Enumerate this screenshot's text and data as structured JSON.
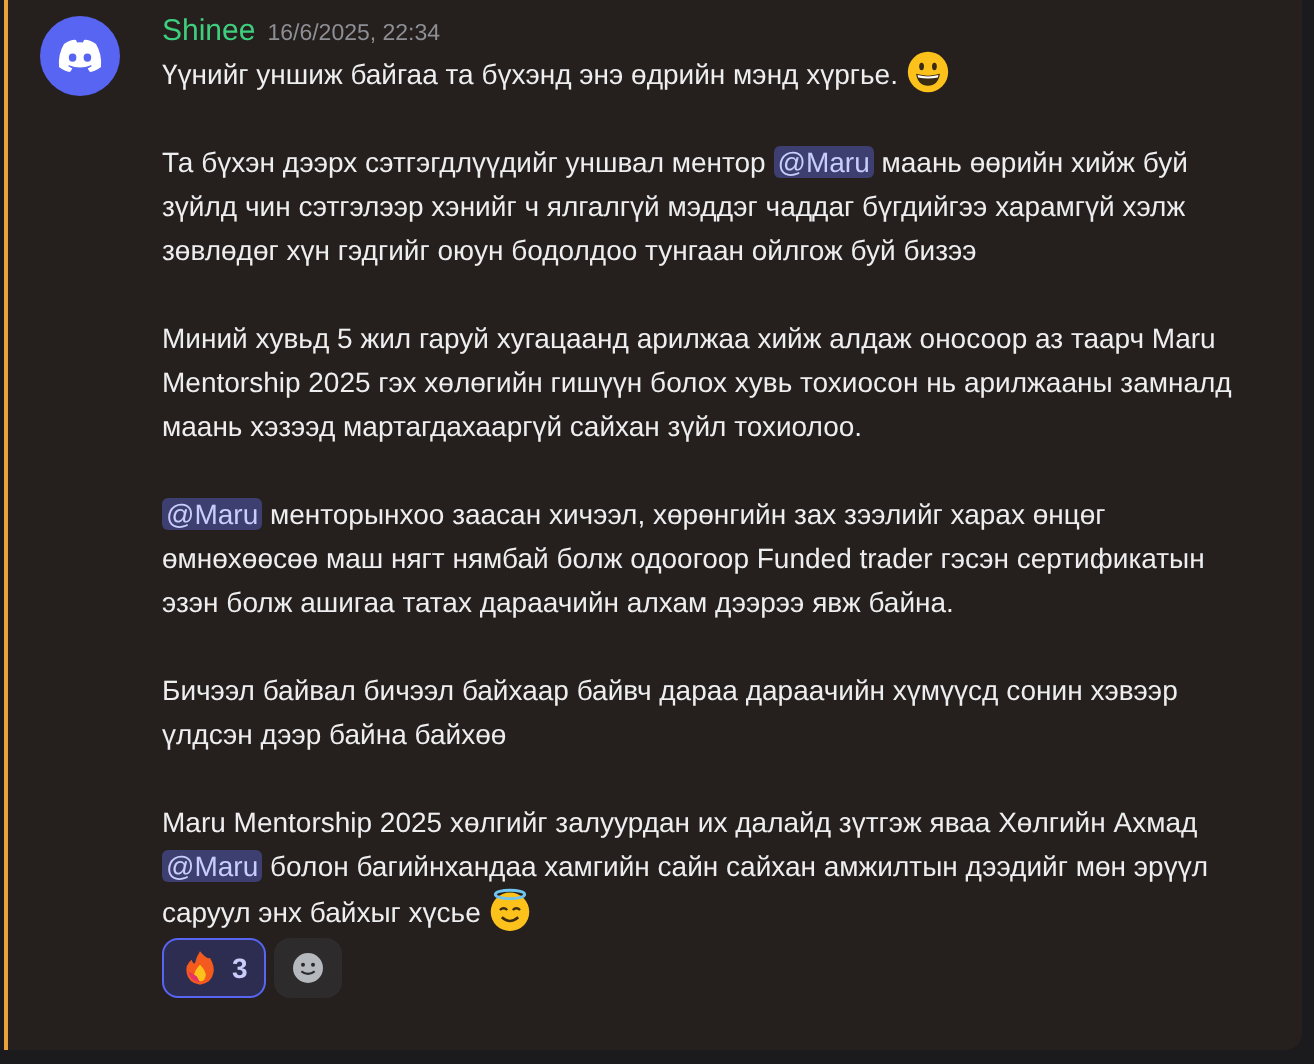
{
  "message": {
    "author": "Shinee",
    "timestamp": "16/6/2025, 22:34",
    "paragraphs": [
      [
        {
          "kind": "text",
          "text": "Үүнийг уншиж байгаа та бүхэнд энэ өдрийн мэнд хүргье. "
        },
        {
          "kind": "grin"
        }
      ],
      [
        {
          "kind": "text",
          "text": "Та бүхэн дээрх сэтгэгдлүүдийг уншвал ментор "
        },
        {
          "kind": "mention",
          "text": "@Maru"
        },
        {
          "kind": "text",
          "text": "  маань өөрийн хийж буй зүйлд чин сэтгэлээр хэнийг ч ялгалгүй мэддэг чаддаг бүгдийгээ харамгүй хэлж зөвлөдөг хүн гэдгийг оюун бодолдоо тунгаан ойлгож буй бизээ"
        }
      ],
      [
        {
          "kind": "text",
          "text": "Миний хувьд 5 жил гаруй хугацаанд арилжаа хийж алдаж оносоор аз таарч Maru Mentorship 2025 гэх хөлөгийн гишүүн болох хувь тохиосон нь арилжааны замналд маань хэзээд мартагдахааргүй сайхан зүйл тохиолоо."
        }
      ],
      [
        {
          "kind": "mention",
          "text": "@Maru"
        },
        {
          "kind": "text",
          "text": "  менторынхоо заасан хичээл, хөрөнгийн зах зээлийг харах өнцөг өмнөхөөсөө маш нягт нямбай болж одоогоор Funded trader гэсэн сертификатын эзэн болж ашигаа татах дараачийн алхам дээрээ явж байна."
        }
      ],
      [
        {
          "kind": "text",
          "text": "Бичээл байвал бичээл байхаар байвч дараа дараачийн хүмүүсд сонин хэвээр үлдсэн дээр байна байхөө"
        }
      ],
      [
        {
          "kind": "text",
          "text": "Maru Mentorship 2025 хөлгийг залуурдан их далайд зүтгэж яваа Хөлгийн Ахмад "
        },
        {
          "kind": "mention",
          "text": "@Maru"
        },
        {
          "kind": "text",
          "text": " болон багийнхандаа хамгийн сайн сайхан амжилтын дээдийг мөн эрүүл саруул энх байхыг хүсье "
        },
        {
          "kind": "halo"
        }
      ]
    ],
    "reactions": [
      {
        "count": "3",
        "selected": true
      }
    ]
  }
}
